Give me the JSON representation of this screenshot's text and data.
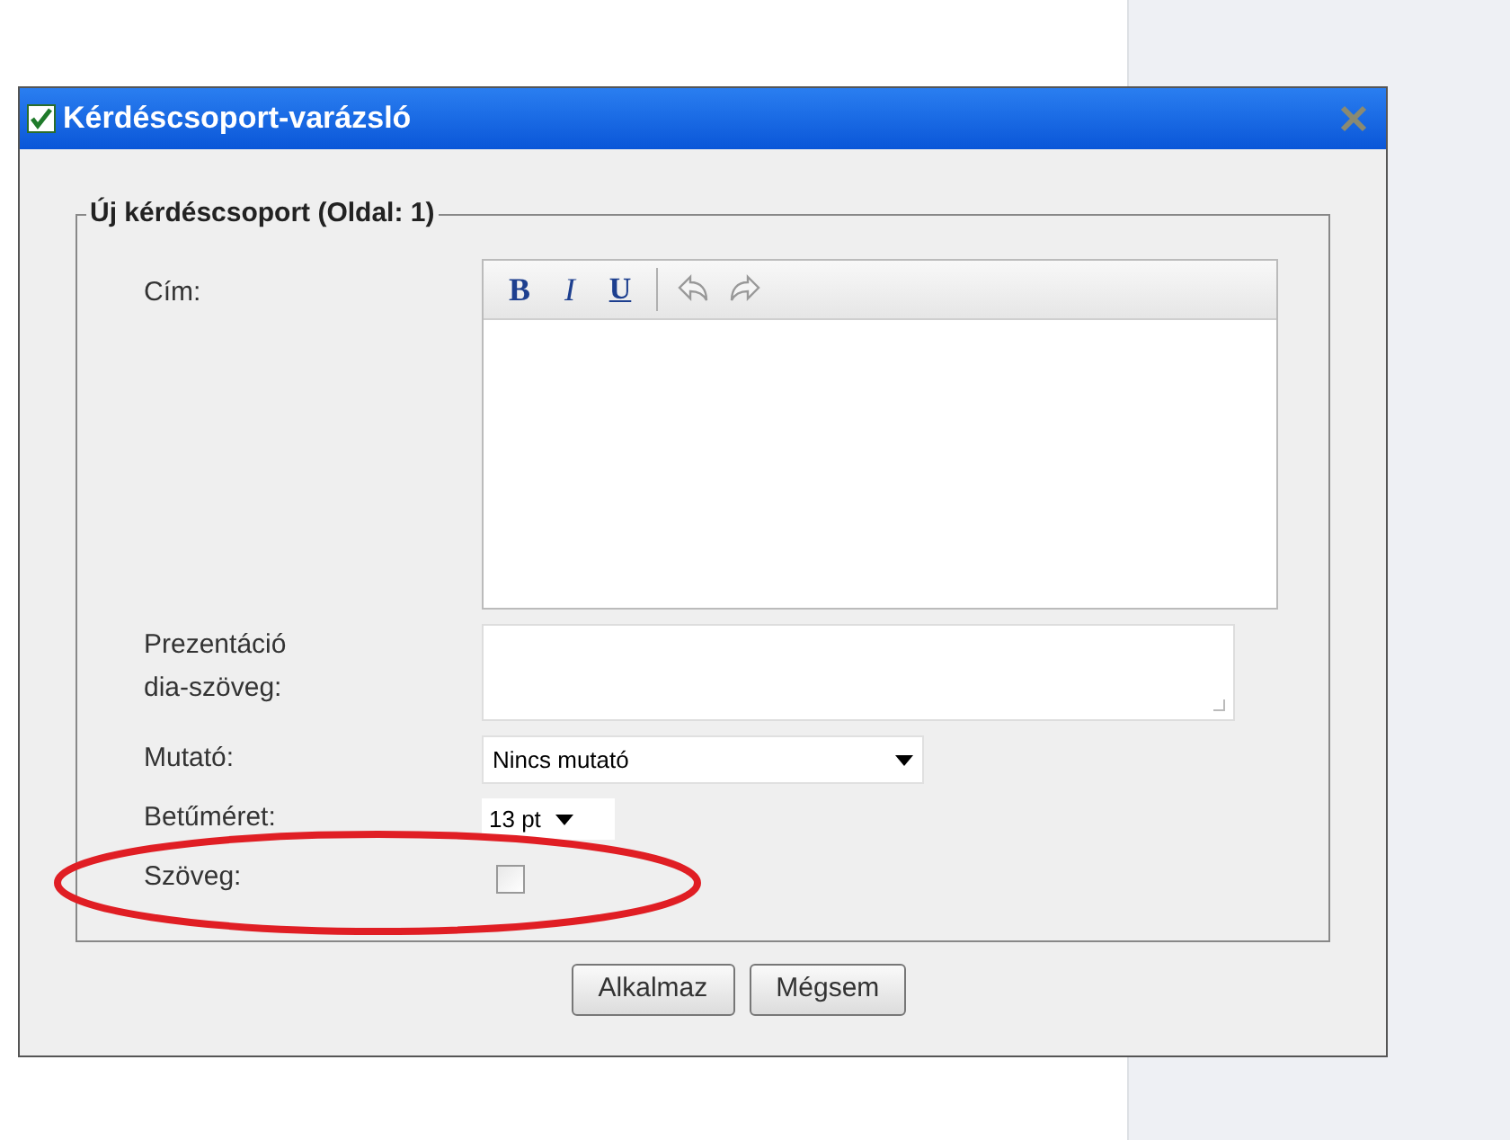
{
  "window": {
    "title": "Kérdéscsoport-varázsló",
    "checked": true
  },
  "group": {
    "legend": "Új kérdéscsoport (Oldal: 1)"
  },
  "title_field": {
    "label": "Cím:",
    "toolbar": [
      {
        "kind": "bold",
        "text": "B"
      },
      {
        "kind": "italic",
        "text": "I"
      },
      {
        "kind": "underline",
        "text": "U"
      },
      {
        "kind": "separator"
      },
      {
        "kind": "undo"
      },
      {
        "kind": "redo"
      }
    ]
  },
  "slide_text": {
    "label": "Prezentáció dia-szöveg:"
  },
  "pointer": {
    "label": "Mutató:",
    "value": "Nincs mutató"
  },
  "font_size": {
    "label": "Betűméret:",
    "value": "13 pt"
  },
  "text_option": {
    "label": "Szöveg:",
    "checked": false
  },
  "buttons": [
    "Alkalmaz",
    "Mégsem"
  ]
}
